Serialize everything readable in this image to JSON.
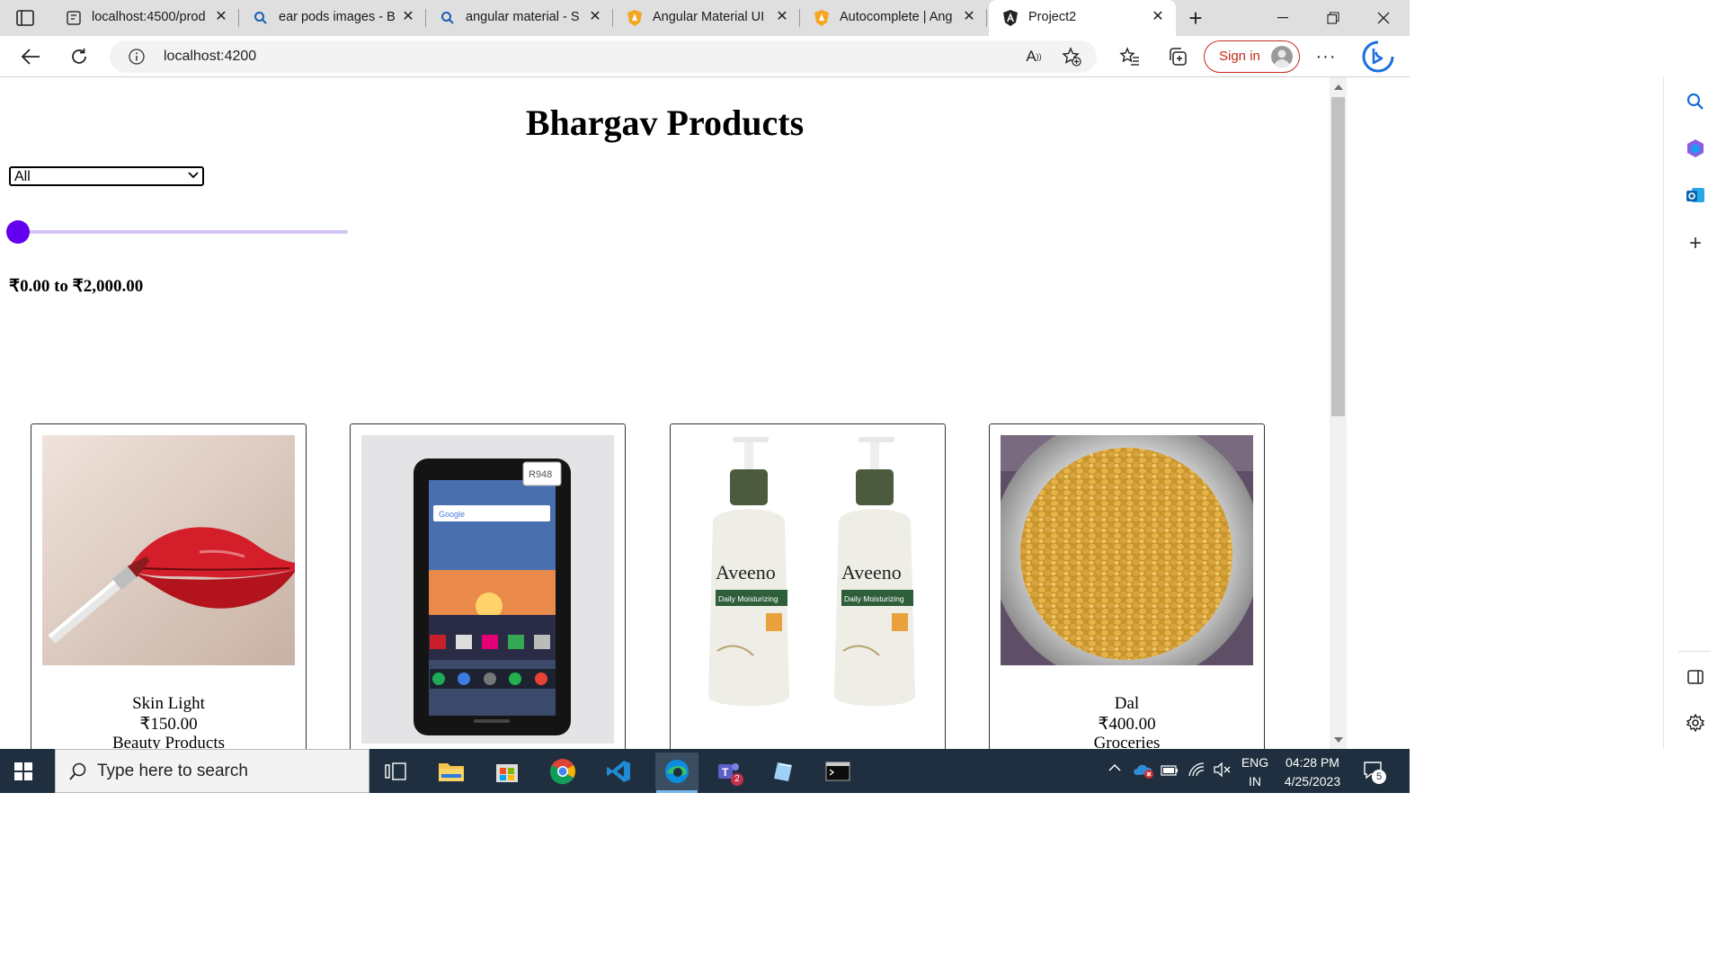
{
  "browser": {
    "tabs": [
      {
        "label": "localhost:4500/prod",
        "icon": "page-icon"
      },
      {
        "label": "ear pods images - B",
        "icon": "search-icon"
      },
      {
        "label": "angular material - S",
        "icon": "search-icon"
      },
      {
        "label": "Angular Material UI",
        "icon": "shield-icon"
      },
      {
        "label": "Autocomplete | Ang",
        "icon": "shield-icon"
      },
      {
        "label": "Project2",
        "icon": "angular-icon"
      }
    ],
    "url": "localhost:4200",
    "sign_in": "Sign in"
  },
  "page": {
    "title": "Bhargav Products",
    "category_select": {
      "value": "All"
    },
    "price_slider": {
      "value_fraction": 0.0
    },
    "price_range": "₹0.00 to ₹2,000.00",
    "products": [
      {
        "name": "Skin Light",
        "price": "₹150.00",
        "category": "Beauty Products"
      },
      {
        "name": "",
        "price": "",
        "category": ""
      },
      {
        "name": "",
        "price": "",
        "category": ""
      },
      {
        "name": "Dal",
        "price": "₹400.00",
        "category": "Groceries"
      }
    ]
  },
  "taskbar": {
    "search_placeholder": "Type here to search",
    "lang_top": "ENG",
    "lang_bottom": "IN",
    "time": "04:28 PM",
    "date": "4/25/2023",
    "notifications": "5",
    "teams_badge": "2"
  },
  "colors": {
    "slider": "#6200ee",
    "taskbar": "#1f2f3f",
    "tab_bar": "#dfdfdf"
  }
}
